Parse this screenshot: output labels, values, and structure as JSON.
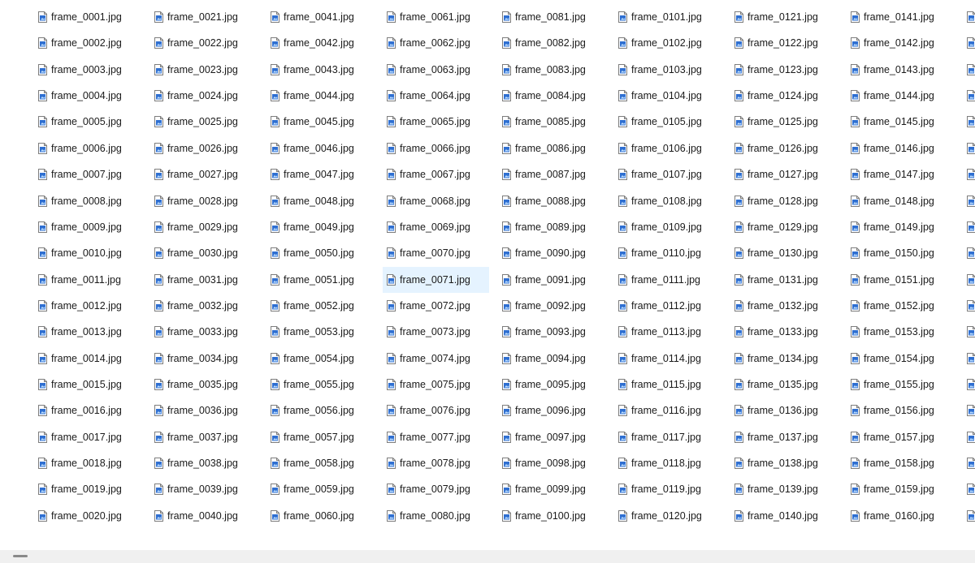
{
  "file_view": {
    "selected_file": "frame_0071.jpg",
    "file_icon": "image-file-icon",
    "columns": [
      {
        "files": [
          "frame_0001.jpg",
          "frame_0002.jpg",
          "frame_0003.jpg",
          "frame_0004.jpg",
          "frame_0005.jpg",
          "frame_0006.jpg",
          "frame_0007.jpg",
          "frame_0008.jpg",
          "frame_0009.jpg",
          "frame_0010.jpg",
          "frame_0011.jpg",
          "frame_0012.jpg",
          "frame_0013.jpg",
          "frame_0014.jpg",
          "frame_0015.jpg",
          "frame_0016.jpg",
          "frame_0017.jpg",
          "frame_0018.jpg",
          "frame_0019.jpg",
          "frame_0020.jpg"
        ]
      },
      {
        "files": [
          "frame_0021.jpg",
          "frame_0022.jpg",
          "frame_0023.jpg",
          "frame_0024.jpg",
          "frame_0025.jpg",
          "frame_0026.jpg",
          "frame_0027.jpg",
          "frame_0028.jpg",
          "frame_0029.jpg",
          "frame_0030.jpg",
          "frame_0031.jpg",
          "frame_0032.jpg",
          "frame_0033.jpg",
          "frame_0034.jpg",
          "frame_0035.jpg",
          "frame_0036.jpg",
          "frame_0037.jpg",
          "frame_0038.jpg",
          "frame_0039.jpg",
          "frame_0040.jpg"
        ]
      },
      {
        "files": [
          "frame_0041.jpg",
          "frame_0042.jpg",
          "frame_0043.jpg",
          "frame_0044.jpg",
          "frame_0045.jpg",
          "frame_0046.jpg",
          "frame_0047.jpg",
          "frame_0048.jpg",
          "frame_0049.jpg",
          "frame_0050.jpg",
          "frame_0051.jpg",
          "frame_0052.jpg",
          "frame_0053.jpg",
          "frame_0054.jpg",
          "frame_0055.jpg",
          "frame_0056.jpg",
          "frame_0057.jpg",
          "frame_0058.jpg",
          "frame_0059.jpg",
          "frame_0060.jpg"
        ]
      },
      {
        "files": [
          "frame_0061.jpg",
          "frame_0062.jpg",
          "frame_0063.jpg",
          "frame_0064.jpg",
          "frame_0065.jpg",
          "frame_0066.jpg",
          "frame_0067.jpg",
          "frame_0068.jpg",
          "frame_0069.jpg",
          "frame_0070.jpg",
          "frame_0071.jpg",
          "frame_0072.jpg",
          "frame_0073.jpg",
          "frame_0074.jpg",
          "frame_0075.jpg",
          "frame_0076.jpg",
          "frame_0077.jpg",
          "frame_0078.jpg",
          "frame_0079.jpg",
          "frame_0080.jpg"
        ]
      },
      {
        "files": [
          "frame_0081.jpg",
          "frame_0082.jpg",
          "frame_0083.jpg",
          "frame_0084.jpg",
          "frame_0085.jpg",
          "frame_0086.jpg",
          "frame_0087.jpg",
          "frame_0088.jpg",
          "frame_0089.jpg",
          "frame_0090.jpg",
          "frame_0091.jpg",
          "frame_0092.jpg",
          "frame_0093.jpg",
          "frame_0094.jpg",
          "frame_0095.jpg",
          "frame_0096.jpg",
          "frame_0097.jpg",
          "frame_0098.jpg",
          "frame_0099.jpg",
          "frame_0100.jpg"
        ]
      },
      {
        "files": [
          "frame_0101.jpg",
          "frame_0102.jpg",
          "frame_0103.jpg",
          "frame_0104.jpg",
          "frame_0105.jpg",
          "frame_0106.jpg",
          "frame_0107.jpg",
          "frame_0108.jpg",
          "frame_0109.jpg",
          "frame_0110.jpg",
          "frame_0111.jpg",
          "frame_0112.jpg",
          "frame_0113.jpg",
          "frame_0114.jpg",
          "frame_0115.jpg",
          "frame_0116.jpg",
          "frame_0117.jpg",
          "frame_0118.jpg",
          "frame_0119.jpg",
          "frame_0120.jpg"
        ]
      },
      {
        "files": [
          "frame_0121.jpg",
          "frame_0122.jpg",
          "frame_0123.jpg",
          "frame_0124.jpg",
          "frame_0125.jpg",
          "frame_0126.jpg",
          "frame_0127.jpg",
          "frame_0128.jpg",
          "frame_0129.jpg",
          "frame_0130.jpg",
          "frame_0131.jpg",
          "frame_0132.jpg",
          "frame_0133.jpg",
          "frame_0134.jpg",
          "frame_0135.jpg",
          "frame_0136.jpg",
          "frame_0137.jpg",
          "frame_0138.jpg",
          "frame_0139.jpg",
          "frame_0140.jpg"
        ]
      },
      {
        "files": [
          "frame_0141.jpg",
          "frame_0142.jpg",
          "frame_0143.jpg",
          "frame_0144.jpg",
          "frame_0145.jpg",
          "frame_0146.jpg",
          "frame_0147.jpg",
          "frame_0148.jpg",
          "frame_0149.jpg",
          "frame_0150.jpg",
          "frame_0151.jpg",
          "frame_0152.jpg",
          "frame_0153.jpg",
          "frame_0154.jpg",
          "frame_0155.jpg",
          "frame_0156.jpg",
          "frame_0157.jpg",
          "frame_0158.jpg",
          "frame_0159.jpg",
          "frame_0160.jpg"
        ]
      },
      {
        "files": [
          "",
          "",
          "",
          "",
          "",
          "",
          "",
          "",
          "",
          "",
          "",
          "",
          "",
          "",
          "",
          "",
          "",
          "",
          "",
          ""
        ]
      }
    ]
  },
  "colors": {
    "selection_bg": "#e5f3ff",
    "icon_blue": "#2f6fd1",
    "scrollbar_bg": "#f0f0f0",
    "scroll_thumb": "#8a8a8a"
  }
}
